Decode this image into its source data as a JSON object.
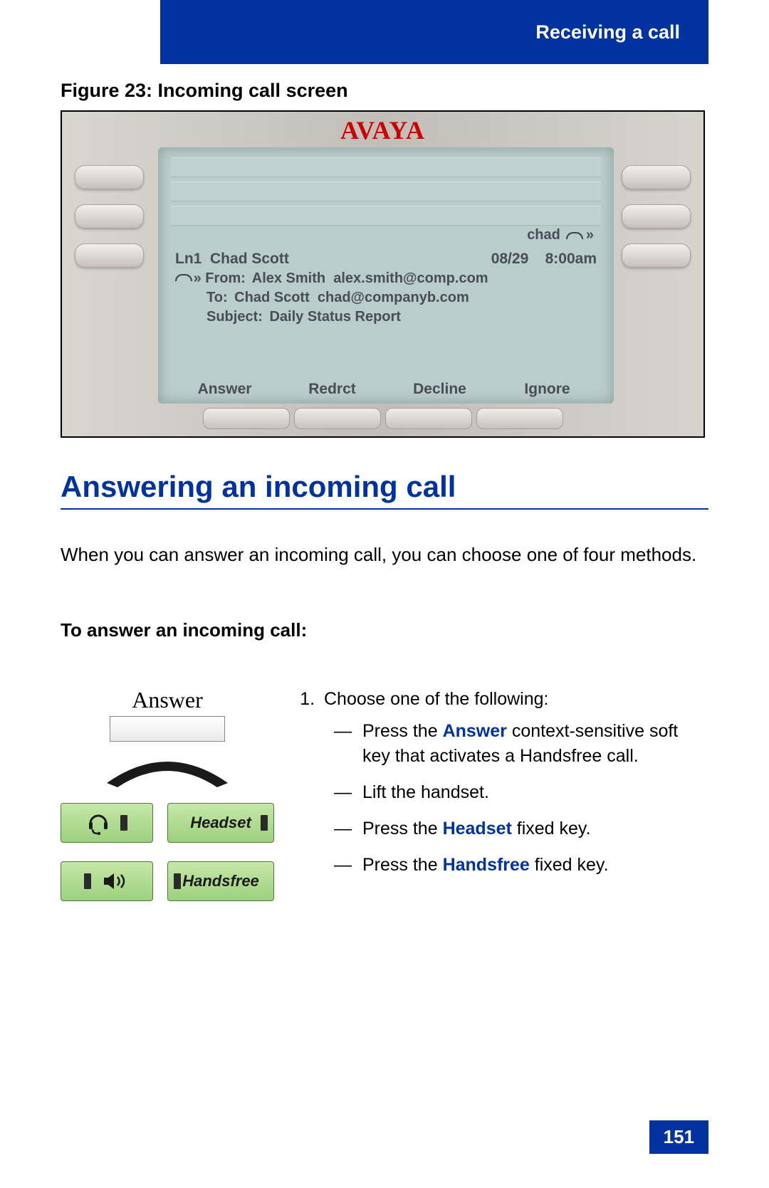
{
  "header": {
    "title": "Receiving a call"
  },
  "figure": {
    "caption": "Figure 23: Incoming call screen",
    "brand": "AVAYA",
    "screen": {
      "status_name": "chad",
      "line_label": "Ln1",
      "caller": "Chad Scott",
      "date": "08/29",
      "time": "8:00am",
      "from_label": "From:",
      "from_name": "Alex Smith",
      "from_addr": "alex.smith@comp.com",
      "to_label": "To:",
      "to_name": "Chad Scott",
      "to_addr": "chad@companyb.com",
      "subject_label": "Subject:",
      "subject": "Daily Status Report",
      "softkeys": [
        "Answer",
        "Redrct",
        "Decline",
        "Ignore"
      ]
    }
  },
  "section": {
    "heading": "Answering an incoming call"
  },
  "intro": "When you can answer an incoming call, you can choose one of four methods.",
  "subhead": "To answer an incoming call:",
  "step": {
    "answer_label": "Answer",
    "headset_key": "Headset",
    "handsfree_key": "Handsfree",
    "lead": "Choose one of the following:",
    "items": {
      "a_pre": "Press the ",
      "a_kw": "Answer",
      "a_post": " context-sensitive soft key that activates a Handsfree call.",
      "b": "Lift the handset.",
      "c_pre": "Press the ",
      "c_kw": "Headset",
      "c_post": " fixed key.",
      "d_pre": "Press the ",
      "d_kw": "Handsfree",
      "d_post": " fixed key."
    }
  },
  "page_number": "151"
}
